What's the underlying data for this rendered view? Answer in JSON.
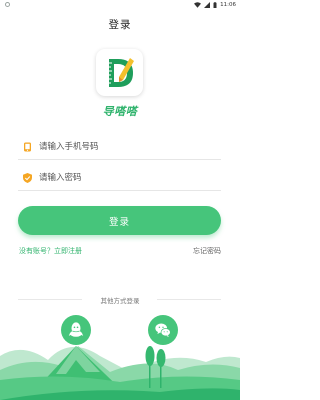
{
  "status_bar": {
    "time": "11:06"
  },
  "header": {
    "title": "登录"
  },
  "app": {
    "name": "导嗒嗒",
    "logo_letter": "D",
    "brand_color": "#46c57b"
  },
  "form": {
    "phone_placeholder": "请输入手机号码",
    "password_placeholder": "请输入密码",
    "login_label": "登录",
    "register_label": "没有账号？立即注册",
    "forgot_label": "忘记密码"
  },
  "other_login": {
    "label": "其他方式登录",
    "options": [
      "qq-icon",
      "wechat-icon"
    ]
  }
}
